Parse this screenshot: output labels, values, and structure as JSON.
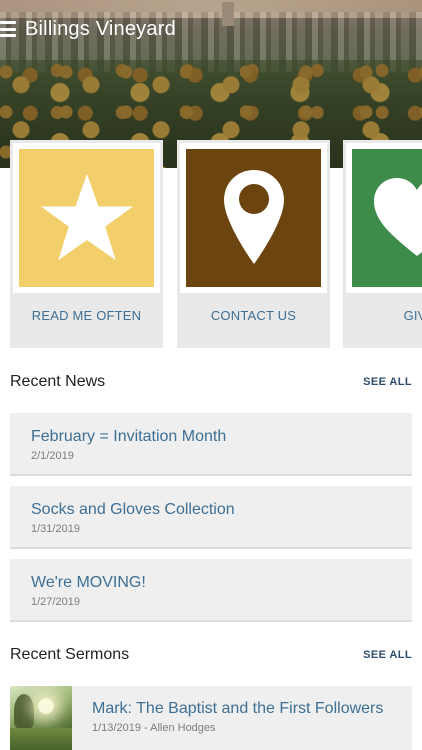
{
  "app": {
    "title": "Billings Vineyard"
  },
  "tiles": [
    {
      "label": "READ ME OFTEN",
      "icon": "star-icon",
      "color": "#f2cf6a"
    },
    {
      "label": "CONTACT US",
      "icon": "map-pin-icon",
      "color": "#6b4410"
    },
    {
      "label": "GIVE",
      "icon": "heart-icon",
      "color": "#3d8c4a"
    }
  ],
  "news": {
    "title": "Recent News",
    "see_all": "SEE ALL",
    "items": [
      {
        "title": "February = Invitation Month",
        "date": "2/1/2019"
      },
      {
        "title": "Socks and Gloves Collection",
        "date": "1/31/2019"
      },
      {
        "title": "We're MOVING!",
        "date": "1/27/2019"
      }
    ]
  },
  "sermons": {
    "title": "Recent Sermons",
    "see_all": "SEE ALL",
    "items": [
      {
        "title": "Mark: The Baptist and the First Followers",
        "meta": "1/13/2019 - Allen Hodges"
      }
    ]
  },
  "colors": {
    "link": "#3e6f94",
    "card_bg": "#efefef"
  }
}
